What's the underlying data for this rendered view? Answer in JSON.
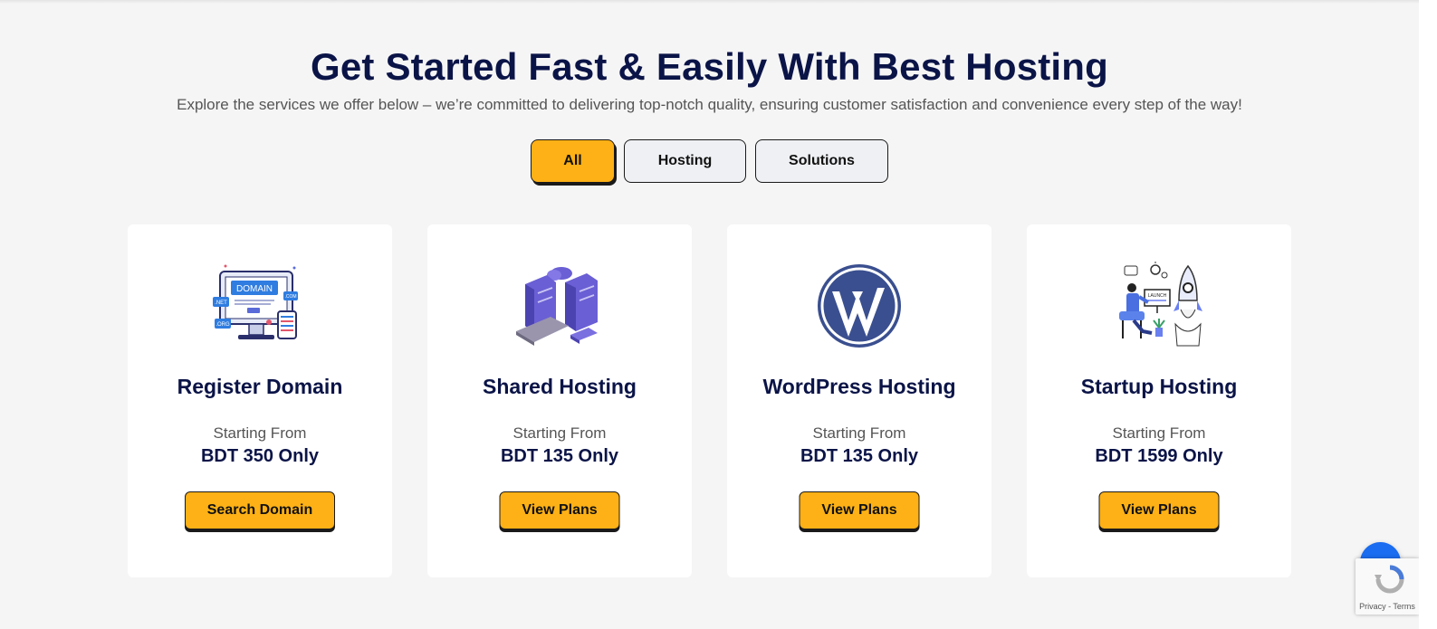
{
  "section": {
    "title": "Get Started Fast & Easily With Best Hosting",
    "subtitle": "Explore the services we offer below – we’re committed to delivering top-notch quality, ensuring customer satisfaction and convenience every step of the way!"
  },
  "tabs": [
    {
      "label": "All",
      "active": true
    },
    {
      "label": "Hosting",
      "active": false
    },
    {
      "label": "Solutions",
      "active": false
    }
  ],
  "cards": [
    {
      "title": "Register Domain",
      "starting_label": "Starting From",
      "price": "BDT 350 Only",
      "button": "Search Domain",
      "icon": "domain-illustration"
    },
    {
      "title": "Shared Hosting",
      "starting_label": "Starting From",
      "price": "BDT 135 Only",
      "button": "View Plans",
      "icon": "server-illustration"
    },
    {
      "title": "WordPress Hosting",
      "starting_label": "Starting From",
      "price": "BDT 135 Only",
      "button": "View Plans",
      "icon": "wordpress-logo"
    },
    {
      "title": "Startup Hosting",
      "starting_label": "Starting From",
      "price": "BDT 1599 Only",
      "button": "View Plans",
      "icon": "startup-rocket-illustration"
    }
  ],
  "domain_illustration_labels": {
    "domain": "DOMAIN",
    "net": ".NET",
    "org": ".ORG",
    "com": ".COM"
  },
  "startup_illustration_label": "LAUNCH",
  "recaptcha": {
    "links": "Privacy - Terms"
  },
  "colors": {
    "accent": "#fdb116",
    "heading": "#0b1447",
    "scroll_button": "#1a6cf0"
  }
}
